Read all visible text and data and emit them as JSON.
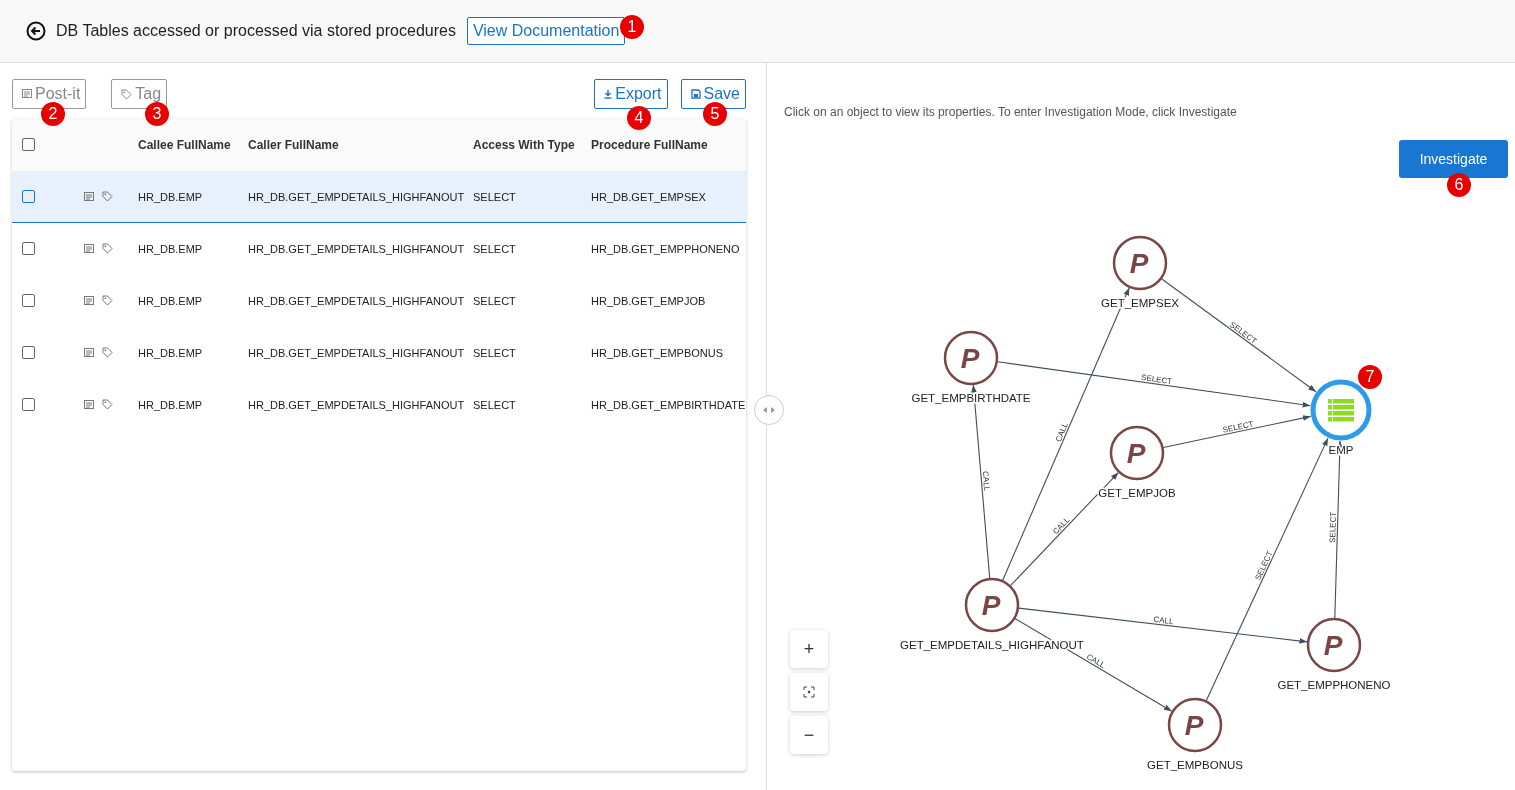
{
  "header": {
    "title": "DB Tables accessed or processed via stored procedures",
    "doc_link": "View Documentation"
  },
  "toolbar": {
    "buttons": [
      {
        "label": "Post-it",
        "kind": "postit",
        "disabled": true
      },
      {
        "label": "Tag",
        "kind": "tag",
        "disabled": true
      },
      {
        "label": "Export",
        "kind": "export",
        "disabled": false
      },
      {
        "label": "Save",
        "kind": "save",
        "disabled": false
      }
    ]
  },
  "table": {
    "header_checked": false,
    "columns": [
      "Callee FullName",
      "Caller FullName",
      "Access With Type",
      "Procedure FullName"
    ],
    "rows": [
      {
        "selected": true,
        "checked": false,
        "cells": [
          "HR_DB.EMP",
          "HR_DB.GET_EMPDETAILS_HIGHFANOUT",
          "SELECT",
          "HR_DB.GET_EMPSEX"
        ]
      },
      {
        "selected": false,
        "checked": false,
        "cells": [
          "HR_DB.EMP",
          "HR_DB.GET_EMPDETAILS_HIGHFANOUT",
          "SELECT",
          "HR_DB.GET_EMPPHONENO"
        ]
      },
      {
        "selected": false,
        "checked": false,
        "cells": [
          "HR_DB.EMP",
          "HR_DB.GET_EMPDETAILS_HIGHFANOUT",
          "SELECT",
          "HR_DB.GET_EMPJOB"
        ]
      },
      {
        "selected": false,
        "checked": false,
        "cells": [
          "HR_DB.EMP",
          "HR_DB.GET_EMPDETAILS_HIGHFANOUT",
          "SELECT",
          "HR_DB.GET_EMPBONUS"
        ]
      },
      {
        "selected": false,
        "checked": false,
        "cells": [
          "HR_DB.EMP",
          "HR_DB.GET_EMPDETAILS_HIGHFANOUT",
          "SELECT",
          "HR_DB.GET_EMPBIRTHDATE"
        ]
      }
    ]
  },
  "graph": {
    "hint": "Click on an object to view its properties. To enter Investigation Mode, click Investigate",
    "investigate": "Investigate",
    "nodes": [
      {
        "name": "GET_EMPSEX",
        "kind": "procedure",
        "glyph": "P",
        "selected": false
      },
      {
        "name": "GET_EMPBIRTHDATE",
        "kind": "procedure",
        "glyph": "P",
        "selected": false
      },
      {
        "name": "EMP",
        "kind": "table",
        "selected": true
      },
      {
        "name": "GET_EMPJOB",
        "kind": "procedure",
        "glyph": "P",
        "selected": false
      },
      {
        "name": "GET_EMPDETAILS_HIGHFANOUT",
        "kind": "procedure",
        "glyph": "P",
        "selected": false
      },
      {
        "name": "GET_EMPPHONENO",
        "kind": "procedure",
        "glyph": "P",
        "selected": false
      },
      {
        "name": "GET_EMPBONUS",
        "kind": "procedure",
        "glyph": "P",
        "selected": false
      }
    ],
    "edges": [
      {
        "label": "SELECT"
      },
      {
        "label": "SELECT"
      },
      {
        "label": "SELECT"
      },
      {
        "label": "SELECT"
      },
      {
        "label": "SELECT"
      },
      {
        "label": "CALL"
      },
      {
        "label": "CALL"
      },
      {
        "label": "CALL"
      },
      {
        "label": "CALL"
      },
      {
        "label": "CALL"
      }
    ],
    "zoom_in": "+",
    "zoom_out": "−"
  },
  "callouts": [
    "1",
    "2",
    "3",
    "4",
    "5",
    "6",
    "7"
  ]
}
